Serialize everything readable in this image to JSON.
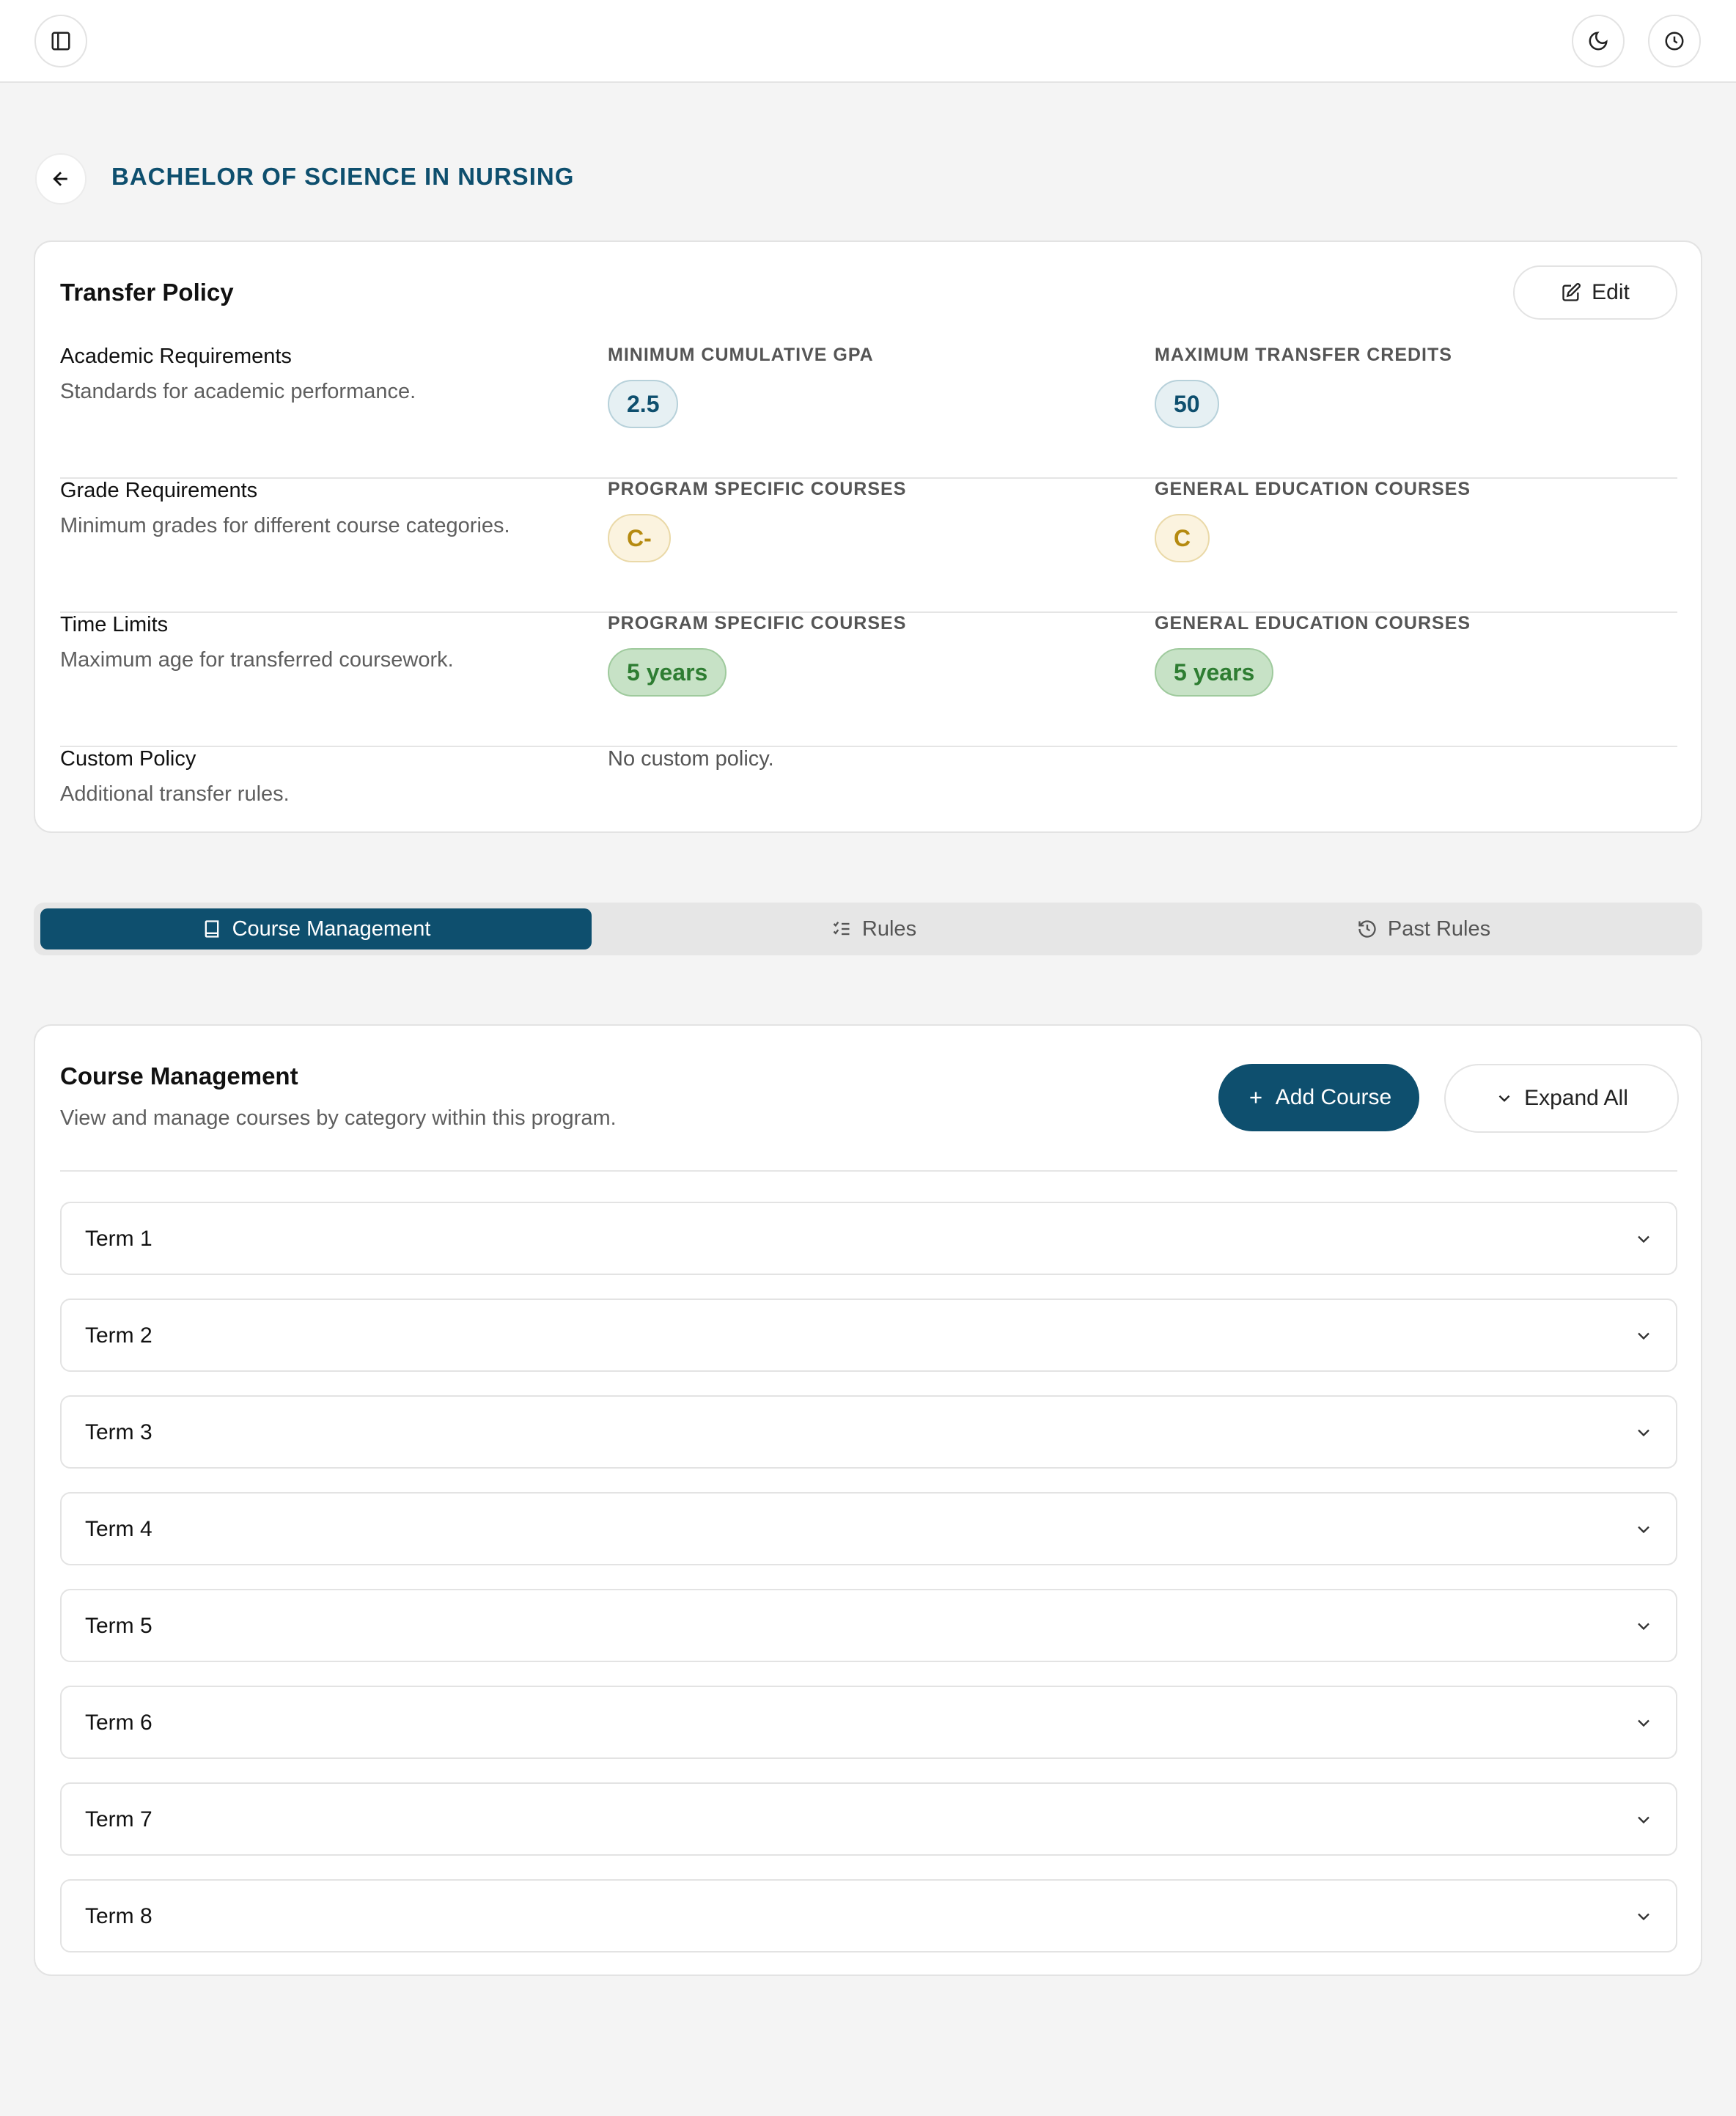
{
  "header": {
    "sidebar_toggle_icon": "sidebar-toggle-icon",
    "theme_icon": "moon-icon",
    "history_icon": "clock-icon"
  },
  "page": {
    "title": "BACHELOR OF SCIENCE IN NURSING",
    "back_icon": "arrow-left-icon"
  },
  "policy": {
    "title": "Transfer Policy",
    "edit_label": "Edit",
    "academic": {
      "title": "Academic Requirements",
      "desc": "Standards for academic performance.",
      "col1_label": "MINIMUM CUMULATIVE GPA",
      "col1_value": "2.5",
      "col2_label": "MAXIMUM TRANSFER CREDITS",
      "col2_value": "50"
    },
    "grade": {
      "title": "Grade Requirements",
      "desc": "Minimum grades for different course categories.",
      "col1_label": "PROGRAM SPECIFIC COURSES",
      "col1_value": "C-",
      "col2_label": "GENERAL EDUCATION COURSES",
      "col2_value": "C"
    },
    "time": {
      "title": "Time Limits",
      "desc": "Maximum age for transferred coursework.",
      "col1_label": "PROGRAM SPECIFIC COURSES",
      "col1_value": "5 years",
      "col2_label": "GENERAL EDUCATION COURSES",
      "col2_value": "5 years"
    },
    "custom": {
      "title": "Custom Policy",
      "desc": "Additional transfer rules.",
      "value": "No custom policy."
    }
  },
  "tabs": [
    {
      "label": "Course Management",
      "icon": "book-icon",
      "active": true
    },
    {
      "label": "Rules",
      "icon": "list-checks-icon",
      "active": false
    },
    {
      "label": "Past Rules",
      "icon": "history-icon",
      "active": false
    }
  ],
  "courses": {
    "title": "Course Management",
    "subtitle": "View and manage courses by category within this program.",
    "add_label": "Add Course",
    "expand_label": "Expand All",
    "terms": [
      "Term 1",
      "Term 2",
      "Term 3",
      "Term 4",
      "Term 5",
      "Term 6",
      "Term 7",
      "Term 8"
    ]
  },
  "colors": {
    "brand": "#0e4f6e",
    "background": "#f4f4f4",
    "grade_yellow": "#b58a10",
    "time_green": "#2e7d32"
  }
}
